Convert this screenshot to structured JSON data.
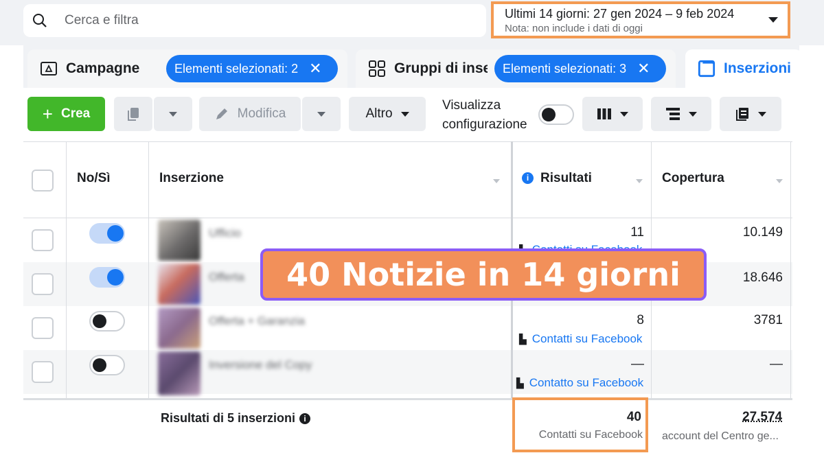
{
  "search": {
    "placeholder": "Cerca e filtra"
  },
  "date_range": {
    "label": "Ultimi 14 giorni: 27 gen 2024 – 9 feb 2024",
    "note": "Nota: non include i dati di oggi"
  },
  "tabs": [
    {
      "label": "Campagne",
      "chip": "Elementi selezionati: 2",
      "icon": "campaign-icon"
    },
    {
      "label": "Gruppi di inserzioni",
      "chip": "Elementi selezionati: 3",
      "icon": "adset-grid-icon"
    },
    {
      "label": "Inserzioni",
      "icon": "ad-icon",
      "active": true
    }
  ],
  "toolbar": {
    "create_label": "Crea",
    "edit_label": "Modifica",
    "more_label": "Altro",
    "view_config_label": "Visualizza configurazione",
    "view_config_on": false
  },
  "table": {
    "headers": {
      "on_off": "No/Sì",
      "ad": "Inserzione",
      "results": "Risultati",
      "reach": "Copertura"
    },
    "rows": [
      {
        "on": true,
        "name": "Ufficio",
        "results": "11",
        "result_type": "Contatti su Facebook",
        "reach": "10.149"
      },
      {
        "on": true,
        "name": "Offerta",
        "results": "",
        "result_type": "",
        "reach": "18.646"
      },
      {
        "on": false,
        "name": "Offerta + Garanzia",
        "results": "8",
        "result_type": "Contatti su Facebook",
        "reach": "3781"
      },
      {
        "on": false,
        "name": "Inversione del Copy",
        "results": "—",
        "result_type": "Contatto su Facebook",
        "reach": "—"
      }
    ],
    "footer": {
      "title": "Risultati di 5 inserzioni",
      "results_total": "40",
      "results_label": "Contatti su Facebook",
      "reach_total": "27.574",
      "reach_label": "account del Centro ge..."
    }
  },
  "overlay": {
    "text": "40 Notizie in 14 giorni"
  },
  "colors": {
    "accent": "#1877f2",
    "create": "#42b72a",
    "highlight": "#f39a52",
    "banner_bg": "#f2905a",
    "banner_border": "#8b5cf6"
  }
}
